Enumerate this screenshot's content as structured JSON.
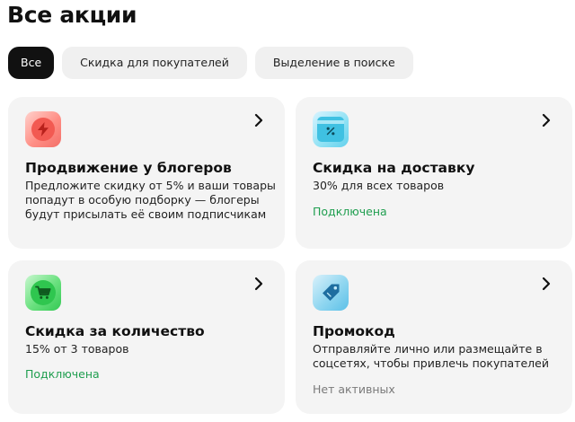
{
  "page": {
    "title": "Все акции"
  },
  "filters": [
    {
      "label": "Все",
      "active": true
    },
    {
      "label": "Скидка для покупателей",
      "active": false
    },
    {
      "label": "Выделение в поиске",
      "active": false
    }
  ],
  "cards": [
    {
      "icon": "lightning-icon",
      "title": "Продвижение у блогеров",
      "description": "Предложите скидку от 5% и ваши товары попадут в особую подборку — блогеры будут присылать её своим подписчикам",
      "status": ""
    },
    {
      "icon": "delivery-discount-icon",
      "title": "Скидка на доставку",
      "description": "30% для всех товаров",
      "status": "Подключена"
    },
    {
      "icon": "cart-icon",
      "title": "Скидка за количество",
      "description": "15% от 3 товаров",
      "status": "Подключена"
    },
    {
      "icon": "promo-tag-icon",
      "title": "Промокод",
      "description": "Отправляйте лично или размещайте в соцсетях, чтобы привлечь покупателей",
      "status": "Нет активных"
    }
  ],
  "colors": {
    "status_active": "#1f9e4f",
    "status_inactive": "#7a7a7a",
    "chip_active": "#111111",
    "card_background": "#f4f4f4"
  }
}
